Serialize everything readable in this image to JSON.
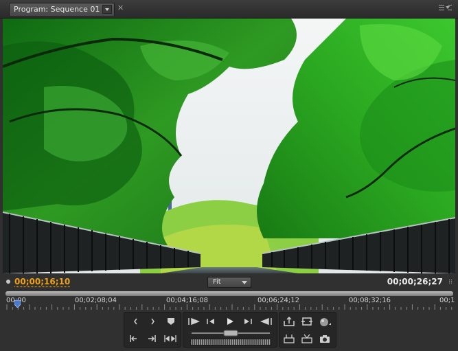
{
  "panel": {
    "tab_label": "Program: Sequence 01",
    "close_glyph": "✕",
    "menu_icon": "panel-menu-icon"
  },
  "viewer": {
    "content": "video frame of bridge under green tree canopy"
  },
  "timecode": {
    "current": "00;00;16;10",
    "duration": "00;00;26;27",
    "zoom": "Fit",
    "accent_color": "#f0a010"
  },
  "ruler": {
    "labels": [
      "00;00",
      "00;02;08;04",
      "00;04;16;08",
      "00;06;24;12",
      "00;08;32;16",
      "00;1"
    ],
    "playhead_position": 0.021
  },
  "transport": {
    "icons": [
      "mark-in-icon",
      "mark-out-icon",
      "set-marker-icon",
      "go-to-in-icon",
      "go-to-out-icon",
      "play-in-to-out-icon",
      "go-to-previous-edit-icon",
      "step-back-icon",
      "play-icon",
      "step-forward-icon",
      "go-to-next-edit-icon",
      "lift-icon",
      "extract-icon",
      "output-icon",
      "trim-monitor-icon",
      "safe-margins-icon",
      "export-frame-icon"
    ]
  }
}
